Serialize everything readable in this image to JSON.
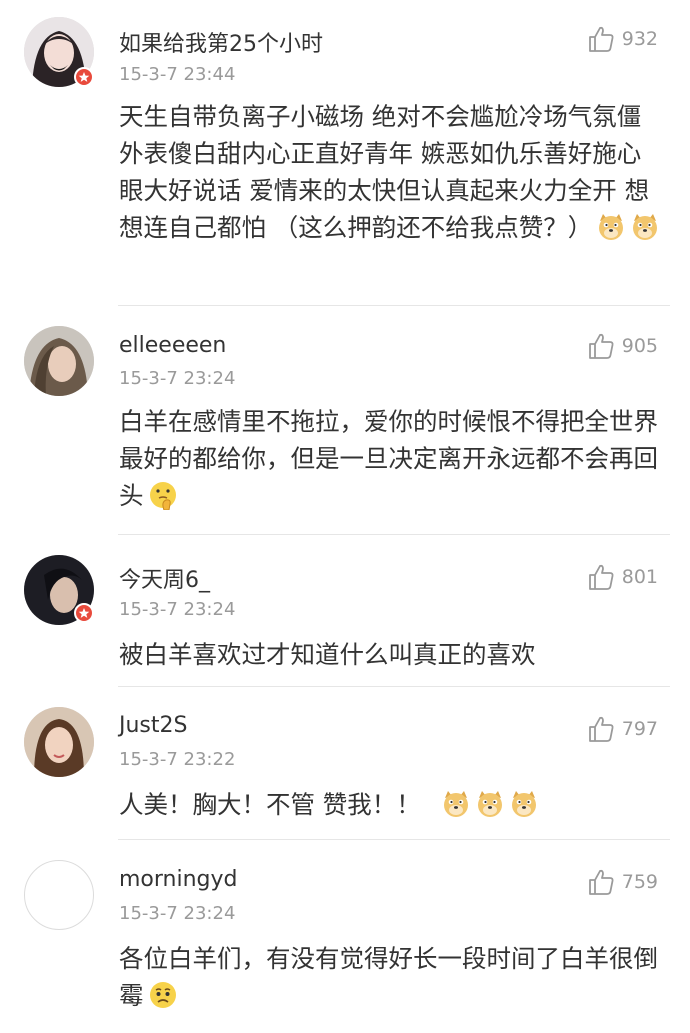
{
  "comments": [
    {
      "username": "如果给我第25个小时",
      "time": "15-3-7 23:44",
      "likes": "932",
      "text": "天生自带负离子小磁场 绝对不会尴尬冷场气氛僵 外表傻白甜内心正直好青年 嫉恶如仇乐善好施心眼大好说话 爱情来的太快但认真起来火力全开 想想连自己都怕 （这么押韵还不给我点赞？）",
      "emojis": [
        "doge-emoji",
        "doge-emoji"
      ],
      "verified": true
    },
    {
      "username": "elleeeeen",
      "time": "15-3-7 23:24",
      "likes": "905",
      "text": "白羊在感情里不拖拉，爱你的时候恨不得把全世界最好的都给你，但是一旦决定离开永远都不会再回头",
      "emojis": [
        "thinking-emoji"
      ],
      "verified": false
    },
    {
      "username": "今天周6_",
      "time": "15-3-7 23:24",
      "likes": "801",
      "text": "被白羊喜欢过才知道什么叫真正的喜欢",
      "emojis": [],
      "verified": true
    },
    {
      "username": "Just2S",
      "time": "15-3-7 23:22",
      "likes": "797",
      "text": "人美！胸大！不管 赞我！！",
      "emojis": [
        "doge-emoji",
        "doge-emoji",
        "doge-emoji"
      ],
      "verified": false
    },
    {
      "username": "morningyd",
      "time": "15-3-7 23:24",
      "likes": "759",
      "text": "各位白羊们，有没有觉得好长一段时间了白羊很倒霉",
      "emojis": [
        "sad-emoji"
      ],
      "verified": false
    }
  ]
}
